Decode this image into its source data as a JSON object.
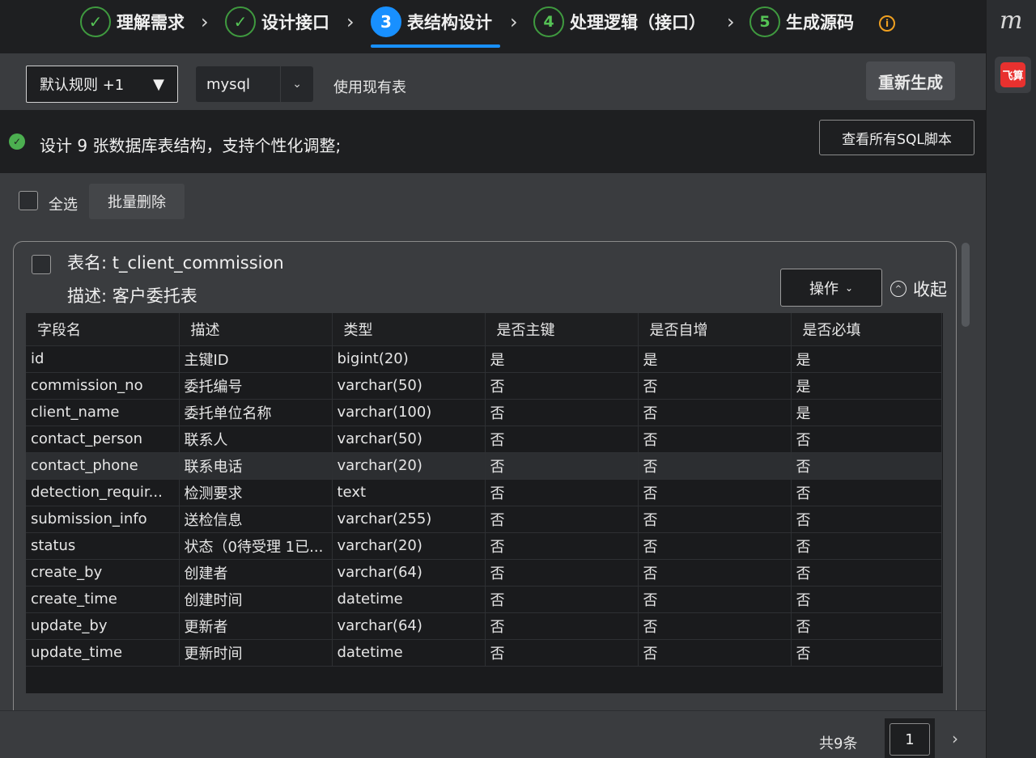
{
  "stepper": {
    "steps": [
      {
        "icon": "✓",
        "label": "理解需求"
      },
      {
        "icon": "✓",
        "label": "设计接口"
      },
      {
        "icon": "3",
        "label": "表结构设计"
      },
      {
        "icon": "4",
        "label": "处理逻辑（接口）"
      },
      {
        "icon": "5",
        "label": "生成源码"
      }
    ],
    "info_icon": "i"
  },
  "toolbar": {
    "rule_select": "默认规则 +1",
    "rule_caret": "▼",
    "db_select": "mysql",
    "db_chevron": "⌄",
    "use_existing": "使用现有表",
    "regenerate": "重新生成"
  },
  "summary": {
    "ok_icon": "✓",
    "text": "设计 9 张数据库表结构，支持个性化调整;",
    "view_sql": "查看所有SQL脚本"
  },
  "select_bar": {
    "select_all": "全选",
    "bulk_delete": "批量删除"
  },
  "card": {
    "table_name": "表名: t_client_commission",
    "table_desc": "描述: 客户委托表",
    "operations": "操作",
    "ops_chevron": "⌄",
    "collapse": "收起",
    "collapse_icon": "^"
  },
  "table": {
    "headers": [
      "字段名",
      "描述",
      "类型",
      "是否主键",
      "是否自增",
      "是否必填"
    ],
    "rows": [
      [
        "id",
        "主键ID",
        "bigint(20)",
        "是",
        "是",
        "是"
      ],
      [
        "commission_no",
        "委托编号",
        "varchar(50)",
        "否",
        "否",
        "是"
      ],
      [
        "client_name",
        "委托单位名称",
        "varchar(100)",
        "否",
        "否",
        "是"
      ],
      [
        "contact_person",
        "联系人",
        "varchar(50)",
        "否",
        "否",
        "否"
      ],
      [
        "contact_phone",
        "联系电话",
        "varchar(20)",
        "否",
        "否",
        "否"
      ],
      [
        "detection_requir...",
        "检测要求",
        "text",
        "否",
        "否",
        "否"
      ],
      [
        "submission_info",
        "送检信息",
        "varchar(255)",
        "否",
        "否",
        "否"
      ],
      [
        "status",
        "状态（0待受理 1已...",
        "varchar(20)",
        "否",
        "否",
        "否"
      ],
      [
        "create_by",
        "创建者",
        "varchar(64)",
        "否",
        "否",
        "否"
      ],
      [
        "create_time",
        "创建时间",
        "datetime",
        "否",
        "否",
        "否"
      ],
      [
        "update_by",
        "更新者",
        "varchar(64)",
        "否",
        "否",
        "否"
      ],
      [
        "update_time",
        "更新时间",
        "datetime",
        "否",
        "否",
        "否"
      ]
    ]
  },
  "pagination": {
    "total": "共9条",
    "page": "1",
    "next": "›"
  },
  "side": {
    "logo": "m",
    "app_label": "飞算"
  },
  "colors": {
    "accent": "#1890ff",
    "success": "#4caf50",
    "warning": "#f0a020",
    "app_red": "#e8312f"
  }
}
